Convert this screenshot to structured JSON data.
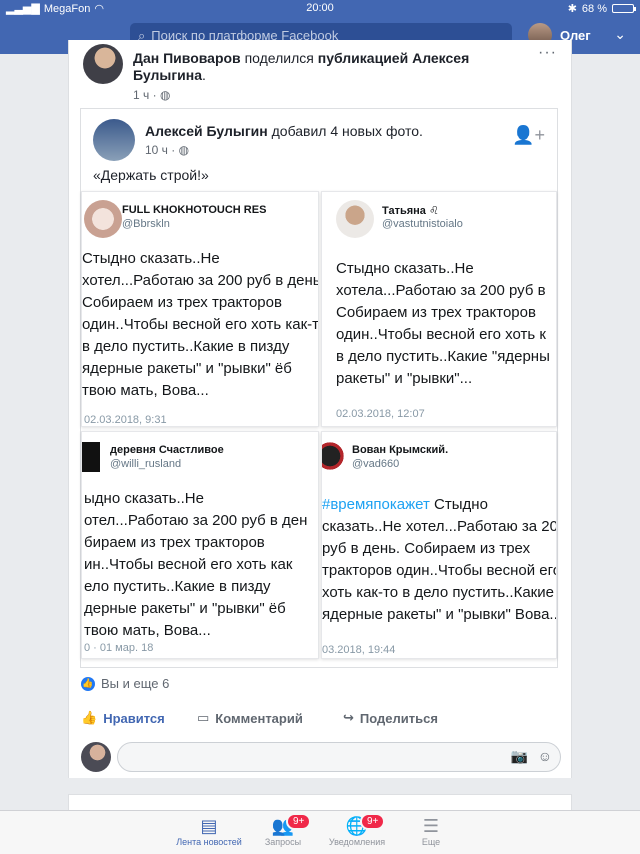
{
  "status": {
    "carrier": "MegaFon",
    "time": "20:00",
    "battery": "68 %",
    "battery_level": 0.68
  },
  "topbar": {
    "search_placeholder": "Поиск по платформе Facebook",
    "user_name": "Олег"
  },
  "post": {
    "author": "Дан Пивоваров",
    "action": "поделился",
    "target": "публикацией Алексея Булыгина",
    "time": "1 ч",
    "shared": {
      "author": "Алексей Булыгин",
      "action": "добавил 4 новых фото.",
      "time": "10 ч",
      "text": "«Держать строй!»"
    },
    "tweets": [
      {
        "name": "FULL KHOKHOTOUCH RES",
        "handle": "@Bbrskln",
        "lines": [
          "Стыдно сказать..Не",
          "хотел...Работаю за 200 руб в день.",
          "Собираем из трех  тракторов",
          "один..Чтобы весной его хоть как-то",
          "в дело пустить..Какие в  пизду",
          "ядерные ракеты\" и \"рывки\" ёб",
          "твою мать, Вова..."
        ],
        "date": "02.03.2018, 9:31"
      },
      {
        "name": "Татьяна ♌",
        "handle": "@vastutnistoialo",
        "lines": [
          "Стыдно сказать..Не",
          "хотела...Работаю за 200 руб в",
          "Собираем из трех  тракторов",
          "один..Чтобы весной его хоть к",
          "в дело пустить..Какие  \"ядерны",
          "ракеты\" и \"рывки\"..."
        ],
        "date": "02.03.2018, 12:07"
      },
      {
        "name": "деревня Счастливое",
        "handle": "@willi_rusland",
        "lines": [
          "ыдно сказать..Не",
          "отел...Работаю за 200 руб в ден",
          "бираем из трех тракторов",
          "ин..Чтобы весной его хоть как",
          "ело пустить..Какие в пизду",
          "дерные ракеты\" и \"рывки\" ёб",
          "твою мать, Вова..."
        ],
        "date": "0 · 01 мар. 18"
      },
      {
        "name": "Вован Крымский.",
        "handle": "@vad660",
        "tag": "#времяпокажет",
        "lines": [
          " Стыдно",
          "сказать..Не хотел...Работаю за 20",
          "руб в день. Собираем из трех",
          "тракторов один..Чтобы весной его",
          "хоть как-то в дело пустить..Какие",
          "ядерные ракеты\" и \"рывки\"  Вова..."
        ],
        "date": "03.2018, 19:44"
      }
    ],
    "reactions": "Вы и еще 6",
    "actions": {
      "like": "Нравится",
      "comment": "Комментарий",
      "share": "Поделиться"
    }
  },
  "tabbar": {
    "feed": "Лента новостей",
    "requests": "Запросы",
    "requests_badge": "9+",
    "notifications": "Уведомления",
    "notifications_badge": "9+",
    "more": "Еще"
  }
}
